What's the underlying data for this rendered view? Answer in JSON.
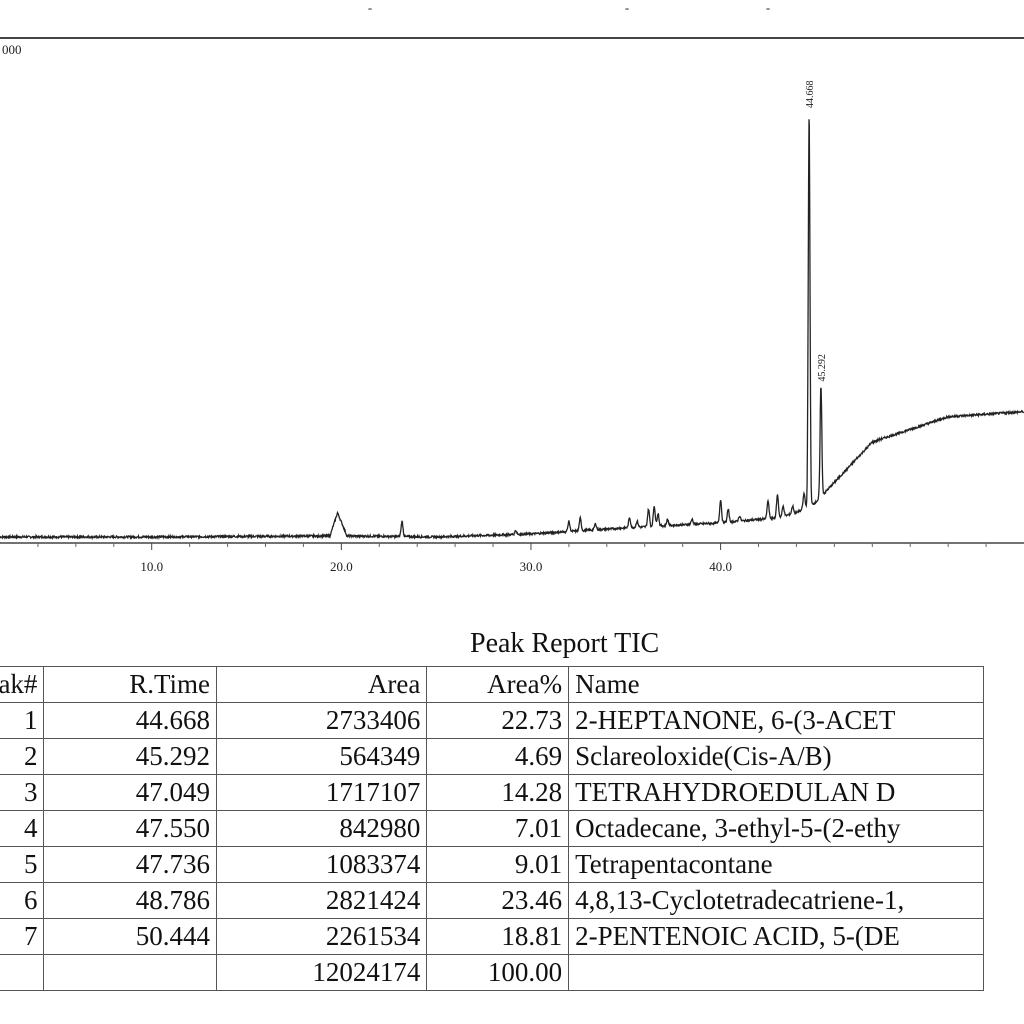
{
  "chart_data": {
    "type": "line",
    "title": "",
    "xlabel": "",
    "ylabel": "",
    "xlim": [
      2.0,
      56.0
    ],
    "ylim": [
      0,
      1.0
    ],
    "y_max_label": "000",
    "top_tick_labels": [
      "-",
      "-",
      "-"
    ],
    "x_ticks": [
      10.0,
      20.0,
      30.0,
      40.0
    ],
    "x_tick_labels": [
      "10.0",
      "20.0",
      "30.0",
      "40.0"
    ],
    "baseline": [
      [
        2.0,
        0.012
      ],
      [
        10.0,
        0.012
      ],
      [
        19.4,
        0.014
      ],
      [
        19.8,
        0.06
      ],
      [
        20.3,
        0.014
      ],
      [
        25.0,
        0.012
      ],
      [
        30.0,
        0.018
      ],
      [
        35.0,
        0.03
      ],
      [
        40.0,
        0.04
      ],
      [
        43.0,
        0.05
      ],
      [
        44.0,
        0.06
      ],
      [
        45.0,
        0.08
      ],
      [
        46.0,
        0.12
      ],
      [
        48.0,
        0.2
      ],
      [
        52.0,
        0.25
      ],
      [
        56.0,
        0.26
      ]
    ],
    "minor_peaks": [
      [
        23.2,
        0.03
      ],
      [
        29.2,
        0.008
      ],
      [
        32.0,
        0.02
      ],
      [
        32.6,
        0.025
      ],
      [
        33.4,
        0.012
      ],
      [
        35.2,
        0.02
      ],
      [
        35.6,
        0.012
      ],
      [
        36.2,
        0.035
      ],
      [
        36.5,
        0.04
      ],
      [
        36.7,
        0.025
      ],
      [
        37.2,
        0.012
      ],
      [
        38.5,
        0.01
      ],
      [
        40.0,
        0.045
      ],
      [
        40.4,
        0.025
      ],
      [
        41.0,
        0.01
      ],
      [
        42.5,
        0.035
      ],
      [
        43.0,
        0.045
      ],
      [
        43.3,
        0.02
      ],
      [
        43.8,
        0.015
      ],
      [
        44.4,
        0.03
      ]
    ],
    "labeled_peaks": [
      {
        "rt": 44.668,
        "label": "44.668",
        "height": 0.78
      },
      {
        "rt": 45.292,
        "label": "45.292",
        "height": 0.22
      }
    ]
  },
  "report": {
    "title": "Peak Report TIC",
    "columns": [
      "ak#",
      "R.Time",
      "Area",
      "Area%",
      "Name"
    ],
    "rows": [
      [
        "1",
        "44.668",
        "2733406",
        "22.73",
        "2-HEPTANONE, 6-(3-ACET"
      ],
      [
        "2",
        "45.292",
        "564349",
        "4.69",
        "Sclareoloxide(Cis-A/B)"
      ],
      [
        "3",
        "47.049",
        "1717107",
        "14.28",
        "TETRAHYDROEDULAN D"
      ],
      [
        "4",
        "47.550",
        "842980",
        "7.01",
        "Octadecane, 3-ethyl-5-(2-ethy"
      ],
      [
        "5",
        "47.736",
        "1083374",
        "9.01",
        "Tetrapentacontane"
      ],
      [
        "6",
        "48.786",
        "2821424",
        "23.46",
        "4,8,13-Cyclotetradecatriene-1,"
      ],
      [
        "7",
        "50.444",
        "2261534",
        "18.81",
        "2-PENTENOIC ACID, 5-(DE"
      ]
    ],
    "totals": [
      "",
      "",
      "12024174",
      "100.00",
      ""
    ]
  }
}
